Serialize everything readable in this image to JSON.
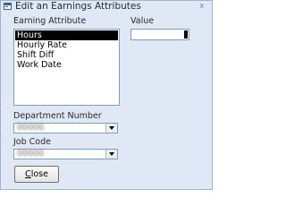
{
  "window": {
    "title": "Edit an Earnings Attributes",
    "close_glyph": "x"
  },
  "earning_attribute": {
    "label": "Earning Attribute",
    "items": [
      "Hours",
      "Hourly Rate",
      "Shift Diff",
      "Work Date"
    ],
    "selected_index": 0
  },
  "value_field": {
    "label": "Value",
    "value": ""
  },
  "department": {
    "label": "Department Number",
    "value": "00000"
  },
  "job_code": {
    "label": "Job Code",
    "value": "00000"
  },
  "buttons": {
    "close_first": "C",
    "close_rest": "lose"
  },
  "colors": {
    "window_bg": "#dfe8f4",
    "selection_bg": "#000000",
    "border": "#7f9db9"
  },
  "icons": {
    "window": "form-window-icon",
    "dropdown": "chevron-down-icon"
  }
}
